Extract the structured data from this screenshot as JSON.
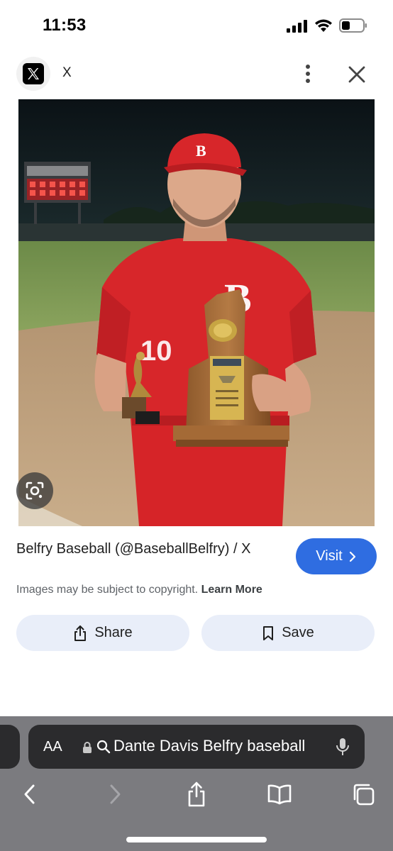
{
  "status_bar": {
    "time": "11:53"
  },
  "source": {
    "name": "X"
  },
  "result": {
    "title": "Belfry Baseball (@BaseballBelfry) / X",
    "visit_label": "Visit",
    "copyright_text": "Images may be subject to copyright.",
    "learn_more_label": "Learn More",
    "share_label": "Share",
    "save_label": "Save"
  },
  "photo": {
    "jersey_number": "10"
  },
  "browser": {
    "aa_label": "AA",
    "search_query": "Dante Davis Belfry baseball"
  },
  "colors": {
    "accent": "#2f6de1",
    "action_bg": "#e9eef9",
    "toolbar_bg": "#7b7b7f"
  }
}
